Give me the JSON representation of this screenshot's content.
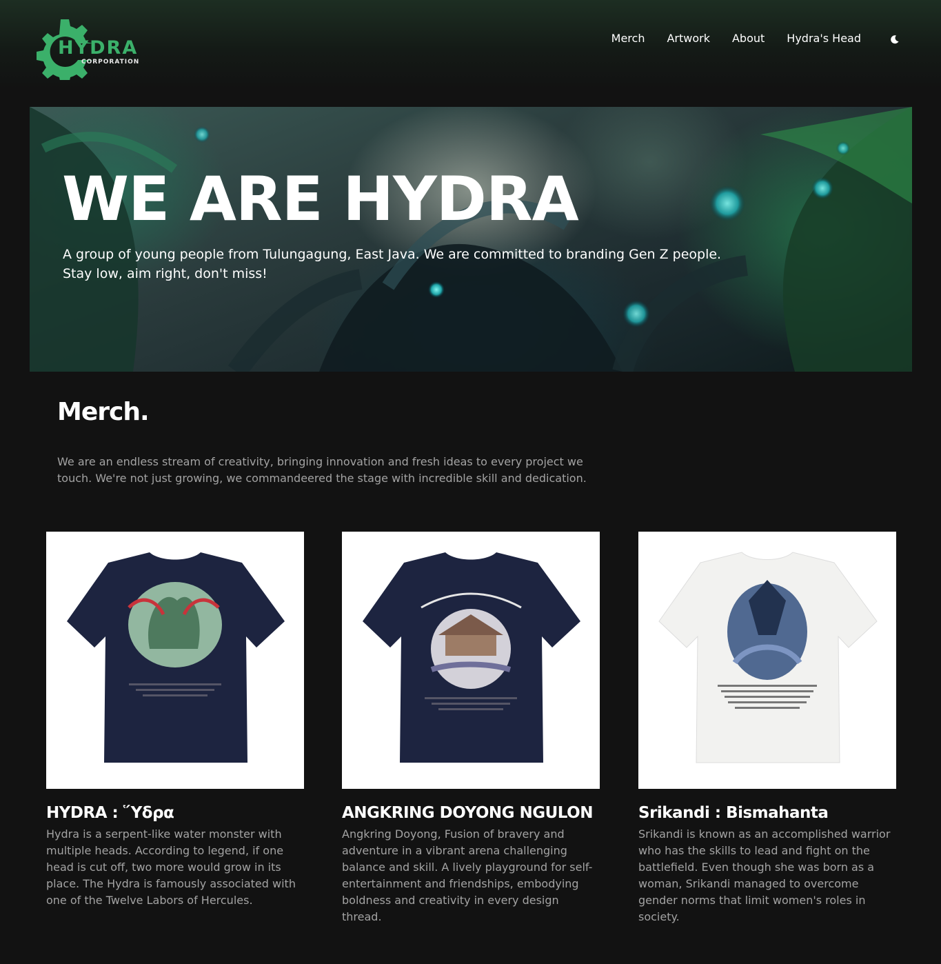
{
  "header": {
    "logo": {
      "word": "HYDRA",
      "sub": "CORPORATION"
    },
    "nav": [
      {
        "label": "Merch"
      },
      {
        "label": "Artwork"
      },
      {
        "label": "About"
      },
      {
        "label": "Hydra's Head"
      }
    ],
    "theme_icon": "moon-icon"
  },
  "hero": {
    "title": "WE ARE HYDRA",
    "description": "A group of young people from Tulungagung, East Java. We are committed to branding Gen Z people. Stay low, aim right, don't miss!"
  },
  "merch": {
    "title": "Merch.",
    "description": "We are an endless stream of creativity, bringing innovation and fresh ideas to every project we touch. We're not just growing, we commandeered the stage with incredible skill and dedication.",
    "items": [
      {
        "title": "HYDRA : Ὕδρα",
        "description": "Hydra is a serpent-like water monster with multiple heads. According to legend, if one head is cut off, two more would grow in its place. The Hydra is famously associated with one of the Twelve Labors of Hercules.",
        "shirt_color": "#1d2440"
      },
      {
        "title": "ANGKRING DOYONG NGULON",
        "description": "Angkring Doyong, Fusion of bravery and adventure in a vibrant arena challenging balance and skill. A lively playground for self-entertainment and friendships, embodying boldness and creativity in every design thread.",
        "shirt_color": "#1d2440"
      },
      {
        "title": "Srikandi : Bismahanta",
        "description": "Srikandi is known as an accomplished warrior who has the skills to lead and fight on the battlefield. Even though she was born as a woman, Srikandi managed to overcome gender norms that limit women's roles in society.",
        "shirt_color": "#f2f2f0"
      }
    ]
  },
  "colors": {
    "background": "#121212",
    "brand_green": "#3bb06a",
    "muted_text": "#a3a3a3"
  }
}
